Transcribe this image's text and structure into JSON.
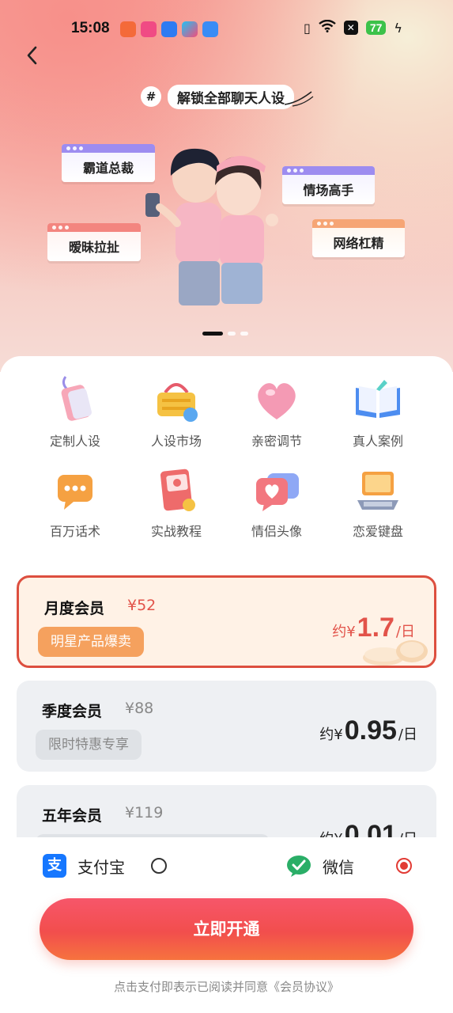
{
  "status_bar": {
    "time": "15:08",
    "battery": "77",
    "app_icons": [
      "app-icon-1",
      "app-icon-2",
      "app-icon-3",
      "app-icon-4",
      "app-icon-5"
    ]
  },
  "hero": {
    "hash": "#",
    "tagline": "解锁全部聊天人设",
    "persona_tags": [
      "霸道总裁",
      "情场高手",
      "暧昧拉扯",
      "网络杠精"
    ],
    "carousel_pages": 3,
    "carousel_active": 0
  },
  "features": [
    {
      "label": "定制人设",
      "icon": "phone-lanyard-icon"
    },
    {
      "label": "人设市场",
      "icon": "shopping-basket-icon"
    },
    {
      "label": "亲密调节",
      "icon": "heart-icon"
    },
    {
      "label": "真人案例",
      "icon": "open-book-icon"
    },
    {
      "label": "百万话术",
      "icon": "chat-bubble-icon"
    },
    {
      "label": "实战教程",
      "icon": "tutorial-book-icon"
    },
    {
      "label": "情侣头像",
      "icon": "heart-chat-icon"
    },
    {
      "label": "恋爱键盘",
      "icon": "laptop-icon"
    }
  ],
  "plans": [
    {
      "name": "月度会员",
      "price": "¥52",
      "badge": "明星产品爆卖",
      "prefix": "约¥",
      "daily": "1.7",
      "suffix": "/日",
      "selected": true
    },
    {
      "name": "季度会员",
      "price": "¥88",
      "badge": "限时特惠专享",
      "prefix": "约¥",
      "daily": "0.95",
      "suffix": "/日",
      "selected": false
    },
    {
      "name": "五年会员",
      "price": "¥119",
      "badge": "",
      "prefix": "约¥",
      "daily": "0.01",
      "suffix": "/日",
      "selected": false
    }
  ],
  "payment": {
    "alipay_label": "支付宝",
    "wechat_label": "微信",
    "selected": "wechat"
  },
  "cta_label": "立即开通",
  "agreement": "点击支付即表示已阅读并同意《会员协议》",
  "colors": {
    "accent": "#e23b34",
    "cta_start": "#f7566a",
    "cta_end": "#f6733e",
    "badge_orange": "#f5a15e",
    "alipay": "#1677ff",
    "wechat": "#2aae67"
  }
}
